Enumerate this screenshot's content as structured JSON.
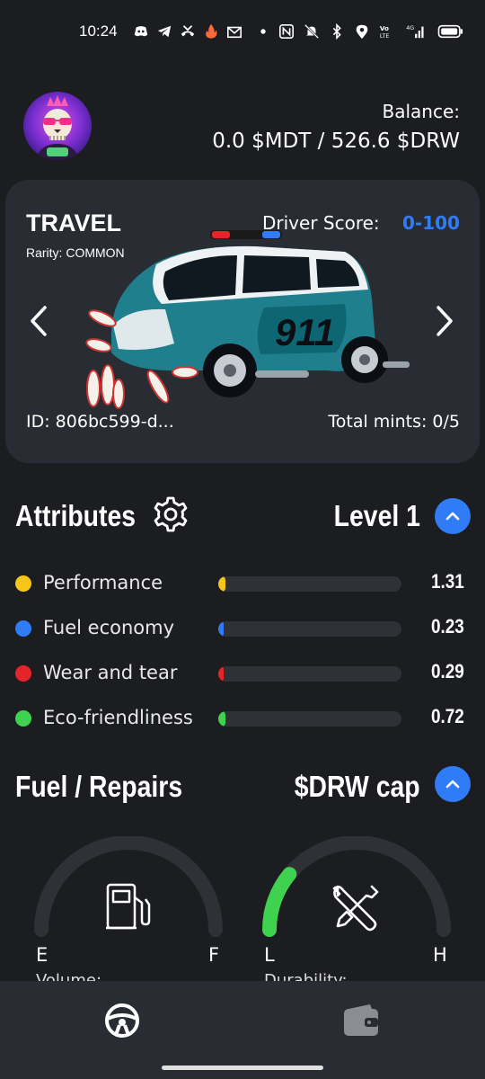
{
  "status_bar": {
    "time": "10:24",
    "left_icons": [
      "discord-icon",
      "telegram-icon",
      "missed-call-icon",
      "fire-icon",
      "mail-icon",
      "dot-icon"
    ],
    "right_icons": [
      "nfc-icon",
      "mute-icon",
      "bluetooth-icon",
      "location-icon",
      "volte-icon",
      "signal-icon",
      "battery-icon"
    ]
  },
  "header": {
    "balance_label": "Balance:",
    "balance_value": "0.0 $MDT / 526.6 $DRW"
  },
  "car": {
    "title": "TRAVEL",
    "rarity": "Rarity: COMMON",
    "driver_score_label": "Driver Score:",
    "driver_score_value": "0-100",
    "id": "ID: 806bc599-d...",
    "mints": "Total mints: 0/5",
    "plate_text": "911"
  },
  "attributes": {
    "title": "Attributes",
    "level": "Level 1",
    "items": [
      {
        "label": "Performance",
        "value": "1.31",
        "color": "#f5c518",
        "fill": 0.04
      },
      {
        "label": "Fuel economy",
        "value": "0.23",
        "color": "#2f7cf6",
        "fill": 0.01
      },
      {
        "label": "Wear and tear",
        "value": "0.29",
        "color": "#e5242a",
        "fill": 0.015
      },
      {
        "label": "Eco-friendliness",
        "value": "0.72",
        "color": "#3fd24f",
        "fill": 0.04
      }
    ]
  },
  "fuel": {
    "title": "Fuel / Repairs",
    "cap": "$DRW cap",
    "fuel_gauge": {
      "min": "E",
      "max": "F",
      "label": "Volume:",
      "level": 0.0
    },
    "repair_gauge": {
      "min": "L",
      "max": "H",
      "label": "Durability:",
      "level": 0.22
    }
  },
  "colors": {
    "accent": "#2f7cf6",
    "background": "#1c1d21",
    "card": "#2a2c33"
  }
}
